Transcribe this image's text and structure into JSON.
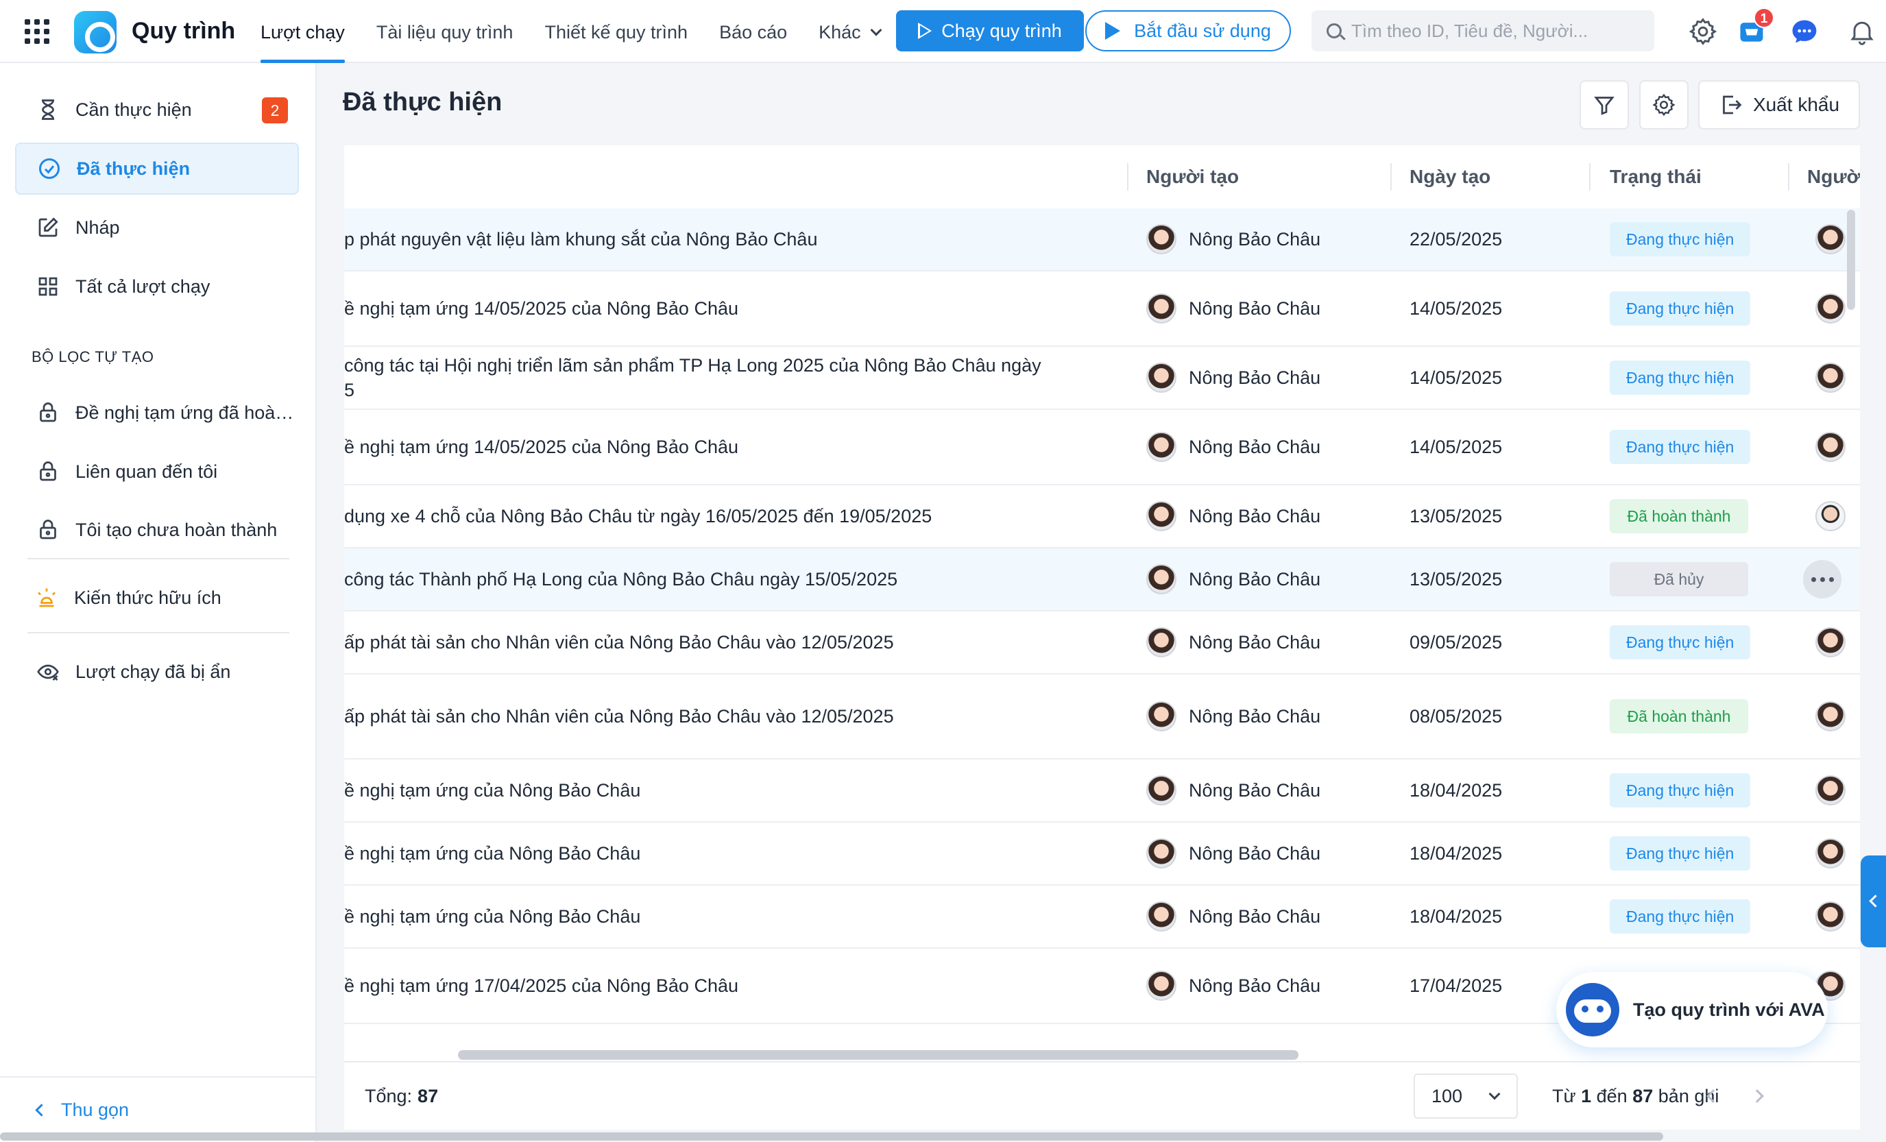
{
  "app": {
    "name": "Quy trình"
  },
  "nav": {
    "items": [
      "Lượt chạy",
      "Tài liệu quy trình",
      "Thiết kế quy trình",
      "Báo cáo"
    ],
    "more_label": "Khác",
    "active": "Lượt chạy"
  },
  "actions": {
    "run_label": "Chạy quy trình",
    "start_label": "Bắt đầu sử dụng"
  },
  "search": {
    "placeholder": "Tìm theo ID, Tiêu đề, Người..."
  },
  "notifications": {
    "cart_badge": "1"
  },
  "sidebar": {
    "items": [
      {
        "label": "Cần thực hiện",
        "badge": "2"
      },
      {
        "label": "Đã thực hiện"
      },
      {
        "label": "Nháp"
      },
      {
        "label": "Tất cả lượt chạy"
      }
    ],
    "custom_filter_title": "BỘ LỌC TỰ TẠO",
    "filters": [
      {
        "label": "Đề nghị tạm ứng đã hoàn ..."
      },
      {
        "label": "Liên quan đến tôi"
      },
      {
        "label": "Tôi tạo chưa hoàn thành"
      }
    ],
    "knowledge_label": "Kiến thức hữu ích",
    "hidden_label": "Lượt chạy đã bị ẩn",
    "collapse_label": "Thu gọn"
  },
  "page": {
    "title": "Đã thực hiện",
    "export_label": "Xuất khẩu"
  },
  "table": {
    "columns": [
      "Người tạo",
      "Ngày tạo",
      "Trạng thái",
      "Người"
    ],
    "rows": [
      {
        "title": [
          "p phát nguyên vật liệu làm khung sắt của Nông Bảo Châu"
        ],
        "creator": "Nông Bảo Châu",
        "date": "22/05/2025",
        "status": "Đang thực hiện",
        "status_kind": "doing"
      },
      {
        "title": [
          "ề nghị tạm ứng 14/05/2025 của Nông Bảo Châu"
        ],
        "creator": "Nông Bảo Châu",
        "date": "14/05/2025",
        "status": "Đang thực hiện",
        "status_kind": "doing"
      },
      {
        "title": [
          "công tác tại Hội nghị triển lãm sản phẩm TP Hạ Long 2025 của Nông Bảo Châu ngày",
          "5"
        ],
        "creator": "Nông Bảo Châu",
        "date": "14/05/2025",
        "status": "Đang thực hiện",
        "status_kind": "doing"
      },
      {
        "title": [
          "ề nghị tạm ứng 14/05/2025 của Nông Bảo Châu"
        ],
        "creator": "Nông Bảo Châu",
        "date": "14/05/2025",
        "status": "Đang thực hiện",
        "status_kind": "doing"
      },
      {
        "title": [
          "dụng xe 4 chỗ của Nông Bảo Châu từ ngày 16/05/2025 đến 19/05/2025"
        ],
        "creator": "Nông Bảo Châu",
        "date": "13/05/2025",
        "status": "Đã hoàn thành",
        "status_kind": "done"
      },
      {
        "title": [
          "công tác Thành phố Hạ Long của Nông Bảo Châu ngày 15/05/2025"
        ],
        "creator": "Nông Bảo Châu",
        "date": "13/05/2025",
        "status": "Đã hủy",
        "status_kind": "cancel"
      },
      {
        "title": [
          "ấp phát tài sản cho Nhân viên của Nông Bảo Châu vào 12/05/2025"
        ],
        "creator": "Nông Bảo Châu",
        "date": "09/05/2025",
        "status": "Đang thực hiện",
        "status_kind": "doing"
      },
      {
        "title": [
          "ấp phát tài sản cho Nhân viên của Nông Bảo Châu vào 12/05/2025"
        ],
        "creator": "Nông Bảo Châu",
        "date": "08/05/2025",
        "status": "Đã hoàn thành",
        "status_kind": "done"
      },
      {
        "title": [
          "ề nghị tạm ứng của Nông Bảo Châu"
        ],
        "creator": "Nông Bảo Châu",
        "date": "18/04/2025",
        "status": "Đang thực hiện",
        "status_kind": "doing"
      },
      {
        "title": [
          "ề nghị tạm ứng của Nông Bảo Châu"
        ],
        "creator": "Nông Bảo Châu",
        "date": "18/04/2025",
        "status": "Đang thực hiện",
        "status_kind": "doing"
      },
      {
        "title": [
          "ề nghị tạm ứng của Nông Bảo Châu"
        ],
        "creator": "Nông Bảo Châu",
        "date": "18/04/2025",
        "status": "Đang thực hiện",
        "status_kind": "doing"
      },
      {
        "title": [
          "ề nghị tạm ứng 17/04/2025 của Nông Bảo Châu"
        ],
        "creator": "Nông Bảo Châu",
        "date": "17/04/2025",
        "status": "",
        "status_kind": "none"
      }
    ]
  },
  "footer": {
    "total_label": "Tổng:",
    "total_value": "87",
    "page_size": "100",
    "range_prefix": "Từ",
    "range_from": "1",
    "range_mid": "đến",
    "range_to": "87",
    "range_suffix": "bản ghi"
  },
  "ava": {
    "label": "Tạo quy trình với AVA"
  },
  "colors": {
    "accent": "#1e88e5",
    "badge": "#f04e23",
    "done": "#1e9e4a"
  }
}
